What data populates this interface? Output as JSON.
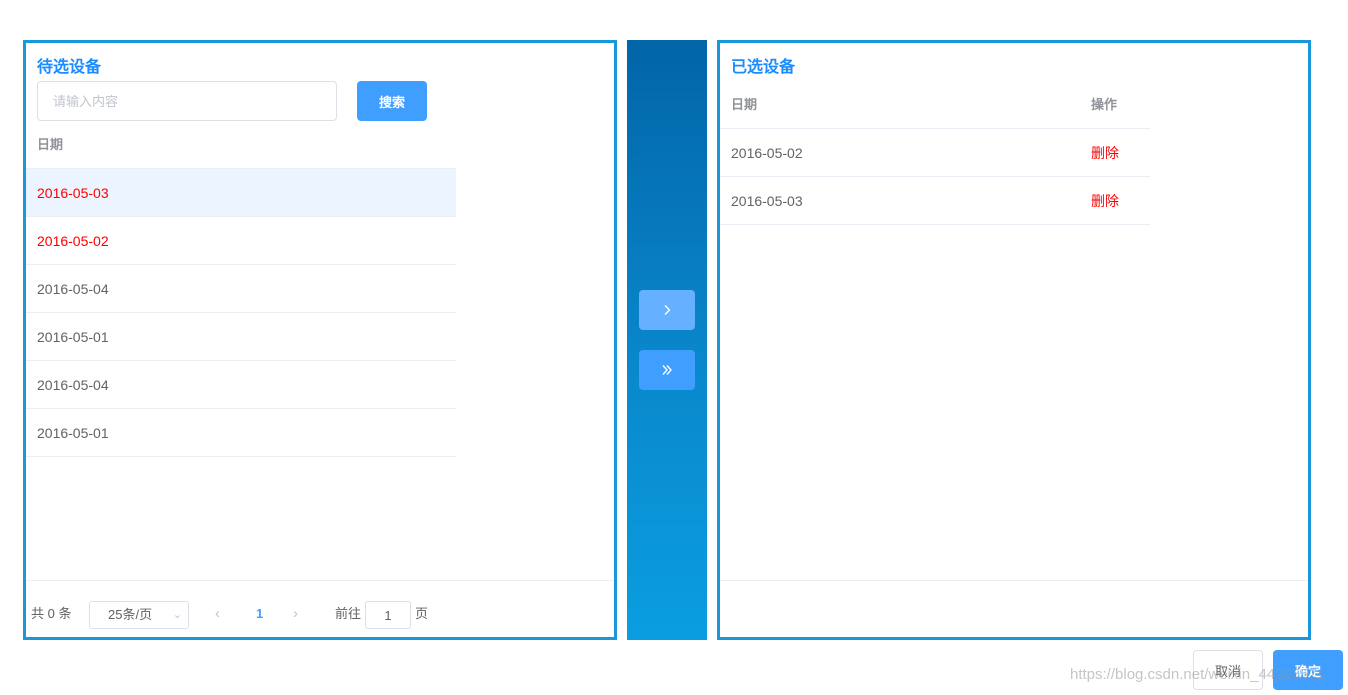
{
  "left_panel": {
    "title": "待选设备",
    "search_placeholder": "请输入内容",
    "search_button": "搜索",
    "column_date": "日期",
    "rows": [
      {
        "date": "2016-05-03"
      },
      {
        "date": "2016-05-02"
      },
      {
        "date": "2016-05-04"
      },
      {
        "date": "2016-05-01"
      },
      {
        "date": "2016-05-04"
      },
      {
        "date": "2016-05-01"
      }
    ],
    "pagination": {
      "total_text": "共 0 条",
      "page_size": "25条/页",
      "current_page": "1",
      "goto_label": "前往",
      "goto_value": "1",
      "goto_unit": "页"
    }
  },
  "right_panel": {
    "title": "已选设备",
    "column_date": "日期",
    "column_action": "操作",
    "rows": [
      {
        "date": "2016-05-02",
        "action": "删除"
      },
      {
        "date": "2016-05-03",
        "action": "删除"
      }
    ]
  },
  "transfer": {
    "move_one_icon": "chevron-right-icon",
    "move_all_icon": "double-chevron-right-icon"
  },
  "dialog_buttons": {
    "cancel": "取消",
    "confirm": "确定"
  },
  "watermark": "https://blog.csdn.net/weixin_44285571",
  "colors": {
    "accent": "#409eff",
    "border": "#1a97d8",
    "title": "#1a8cff",
    "selected_text": "#ff0000",
    "highlight_row": "#ecf5ff"
  }
}
